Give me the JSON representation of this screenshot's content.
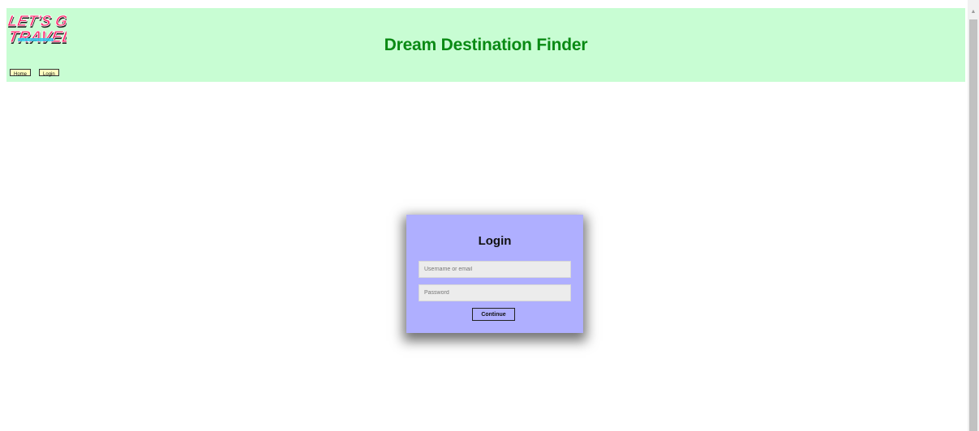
{
  "header": {
    "title": "Dream Destination Finder",
    "logo_text": "LET'S GO TRAVEL",
    "nav": {
      "home_label": "Home",
      "login_label": "Login"
    },
    "background_color": "#c8fdd3",
    "title_color": "#0a8a14"
  },
  "login": {
    "title": "Login",
    "username_placeholder": "Username or email",
    "username_value": "",
    "password_placeholder": "Password",
    "password_value": "",
    "continue_label": "Continue",
    "card_color": "#afafff"
  },
  "icons": {
    "logo": "lets-go-travel-logo",
    "scroll_up": "chevron-up-icon"
  }
}
